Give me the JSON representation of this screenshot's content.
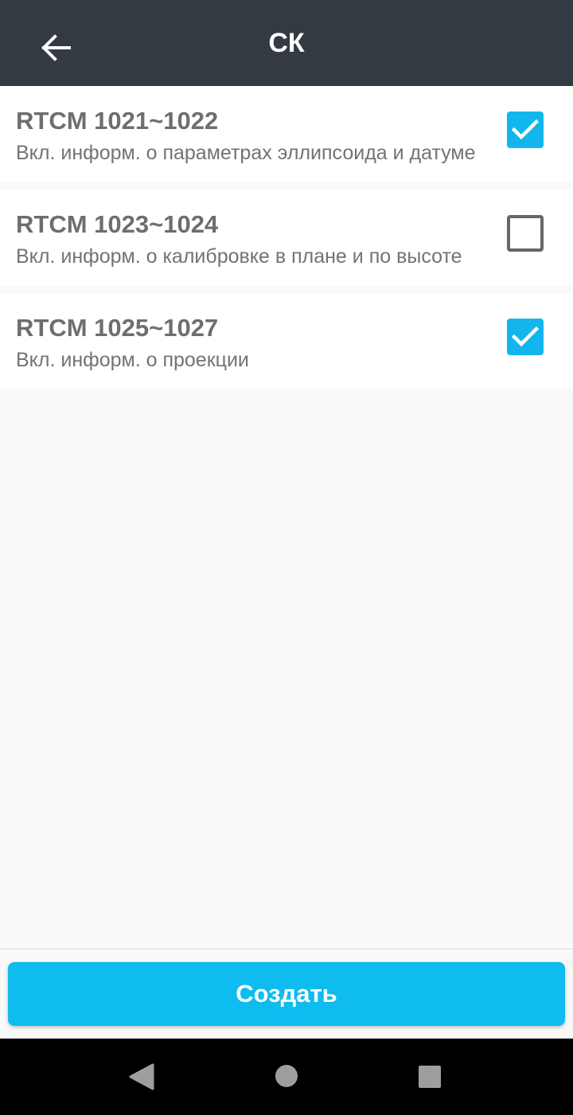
{
  "header": {
    "title": "СК",
    "back_icon": "arrow-left-icon"
  },
  "items": [
    {
      "title": "RTCM 1021~1022",
      "subtitle": "Вкл. информ. о параметрах эллипсоида и датуме",
      "checked": true
    },
    {
      "title": "RTCM 1023~1024",
      "subtitle": "Вкл. информ. о калибровке в плане и по высоте",
      "checked": false
    },
    {
      "title": "RTCM 1025~1027",
      "subtitle": "Вкл. информ. о проекции",
      "checked": true
    }
  ],
  "footer": {
    "create_label": "Создать"
  },
  "navbar": {
    "back_icon": "triangle-back-icon",
    "home_icon": "circle-home-icon",
    "recent_icon": "square-recents-icon"
  },
  "colors": {
    "appbar": "#343a42",
    "accent": "#0ebcef",
    "checkbox_checked": "#13b6ec",
    "background": "#f9f9f9"
  }
}
